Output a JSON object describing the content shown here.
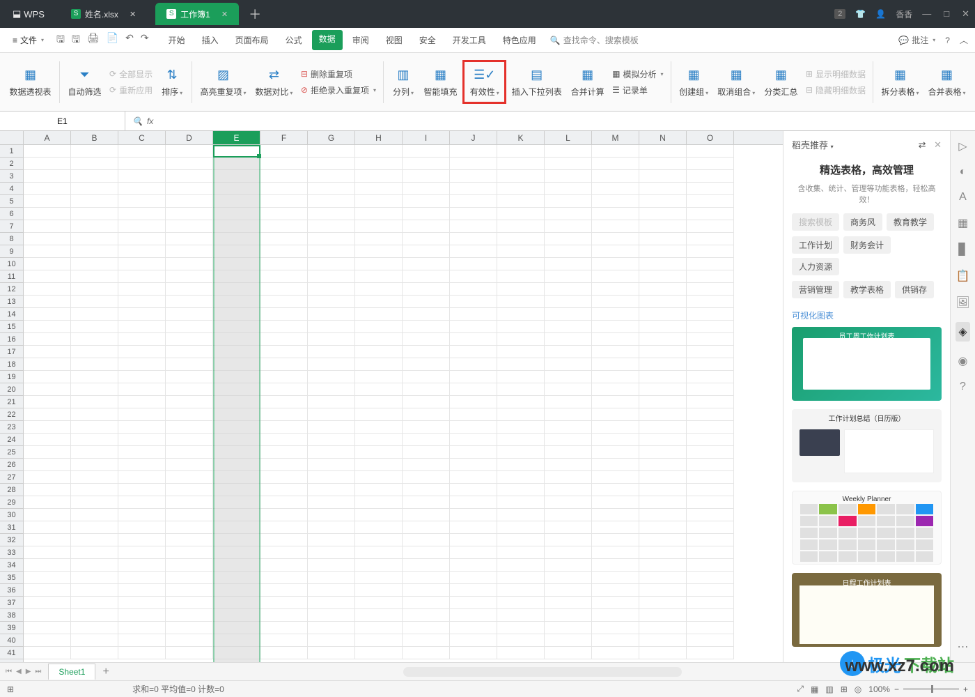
{
  "titlebar": {
    "app": "WPS",
    "tabs": [
      {
        "label": "姓名.xlsx",
        "active": false
      },
      {
        "label": "工作簿1",
        "active": true
      }
    ],
    "right": {
      "count": "2",
      "user": "香香"
    }
  },
  "menubar": {
    "file": "文件",
    "tabs": [
      "开始",
      "插入",
      "页面布局",
      "公式",
      "数据",
      "审阅",
      "视图",
      "安全",
      "开发工具",
      "特色应用"
    ],
    "active_tab": "数据",
    "search_placeholder": "查找命令、搜索模板",
    "annotate": "批注"
  },
  "ribbon": {
    "pivot": "数据透视表",
    "auto_filter": "自动筛选",
    "show_all": "全部显示",
    "reapply": "重新应用",
    "sort": "排序",
    "highlight_dup": "高亮重复项",
    "data_compare": "数据对比",
    "remove_dup": "删除重复项",
    "reject_dup": "拒绝录入重复项",
    "split_cols": "分列",
    "smart_fill": "智能填充",
    "validation": "有效性",
    "insert_dropdown": "插入下拉列表",
    "consolidate": "合并计算",
    "simulate": "模拟分析",
    "record_form": "记录单",
    "create_group": "创建组",
    "ungroup": "取消组合",
    "subtotal": "分类汇总",
    "show_detail": "显示明细数据",
    "hide_detail": "隐藏明细数据",
    "split_table": "拆分表格",
    "merge_table": "合并表格"
  },
  "formula_bar": {
    "name_box": "E1",
    "fx": "fx"
  },
  "columns": [
    "A",
    "B",
    "C",
    "D",
    "E",
    "F",
    "G",
    "H",
    "I",
    "J",
    "K",
    "L",
    "M",
    "N",
    "O"
  ],
  "selected_column": "E",
  "row_count": 41,
  "side": {
    "header": "稻壳推荐",
    "title": "精选表格，高效管理",
    "subtitle": "含收集、统计、管理等功能表格，轻松高效！",
    "filter_groups": [
      [
        "搜索模板",
        "商务风",
        "教育教学"
      ],
      [
        "工作计划",
        "财务会计",
        "人力资源"
      ],
      [
        "营销管理",
        "教学表格",
        "供销存"
      ]
    ],
    "section": "可视化图表",
    "templates": [
      {
        "title": "员工周工作计划表"
      },
      {
        "title": "工作计划总结（日历版）"
      },
      {
        "title": "Weekly Planner"
      },
      {
        "title": "日程工作计划表"
      }
    ]
  },
  "sheet_tabs": {
    "active": "Sheet1"
  },
  "status": {
    "stats": "求和=0   平均值=0   计数=0",
    "zoom": "100%"
  },
  "watermark": {
    "t1": "极光",
    "t2": "下载站",
    "url": "www.xz7.com"
  }
}
